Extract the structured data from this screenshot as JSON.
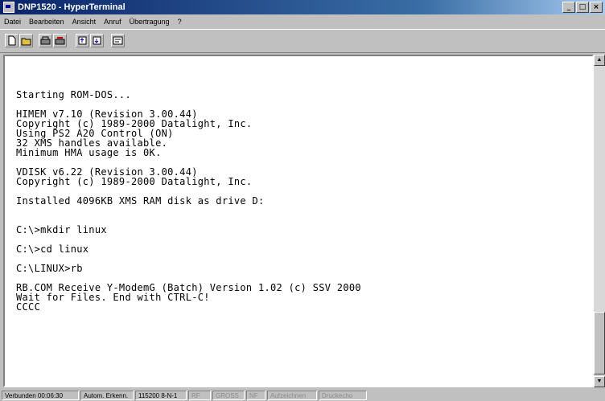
{
  "window": {
    "title": "DNP1520 - HyperTerminal",
    "controls": {
      "minimize": "_",
      "maximize": "□",
      "close": "×"
    }
  },
  "menu": {
    "items": [
      "Datei",
      "Bearbeiten",
      "Ansicht",
      "Anruf",
      "Übertragung",
      "?"
    ]
  },
  "toolbar": {
    "buttons": [
      "new-icon",
      "open-icon",
      "connect-icon",
      "disconnect-icon",
      "send-icon",
      "receive-icon",
      "properties-icon"
    ]
  },
  "terminal": {
    "lines": [
      "",
      "Starting ROM-DOS...",
      "",
      "HIMEM v7.10 (Revision 3.00.44)",
      "Copyright (c) 1989-2000 Datalight, Inc.",
      "Using PS2 A20 Control (ON)",
      "32 XMS handles available.",
      "Minimum HMA usage is 0K.",
      "",
      "VDISK v6.22 (Revision 3.00.44)",
      "Copyright (c) 1989-2000 Datalight, Inc.",
      "",
      "Installed 4096KB XMS RAM disk as drive D:",
      "",
      "",
      "C:\\>mkdir linux",
      "",
      "C:\\>cd linux",
      "",
      "C:\\LINUX>rb",
      "",
      "RB.COM Receive Y-ModemG (Batch) Version 1.02 (c) SSV 2000",
      "Wait for Files. End with CTRL-C!",
      "CCCC"
    ]
  },
  "status": {
    "connected": "Verbunden 00:06:30",
    "detect": "Autom. Erkenn.",
    "settings": "115200 8-N-1",
    "scroll": "RF",
    "caps": "GROSS",
    "num": "NF",
    "capture": "Aufzeichnen",
    "print": "Druckecho"
  }
}
